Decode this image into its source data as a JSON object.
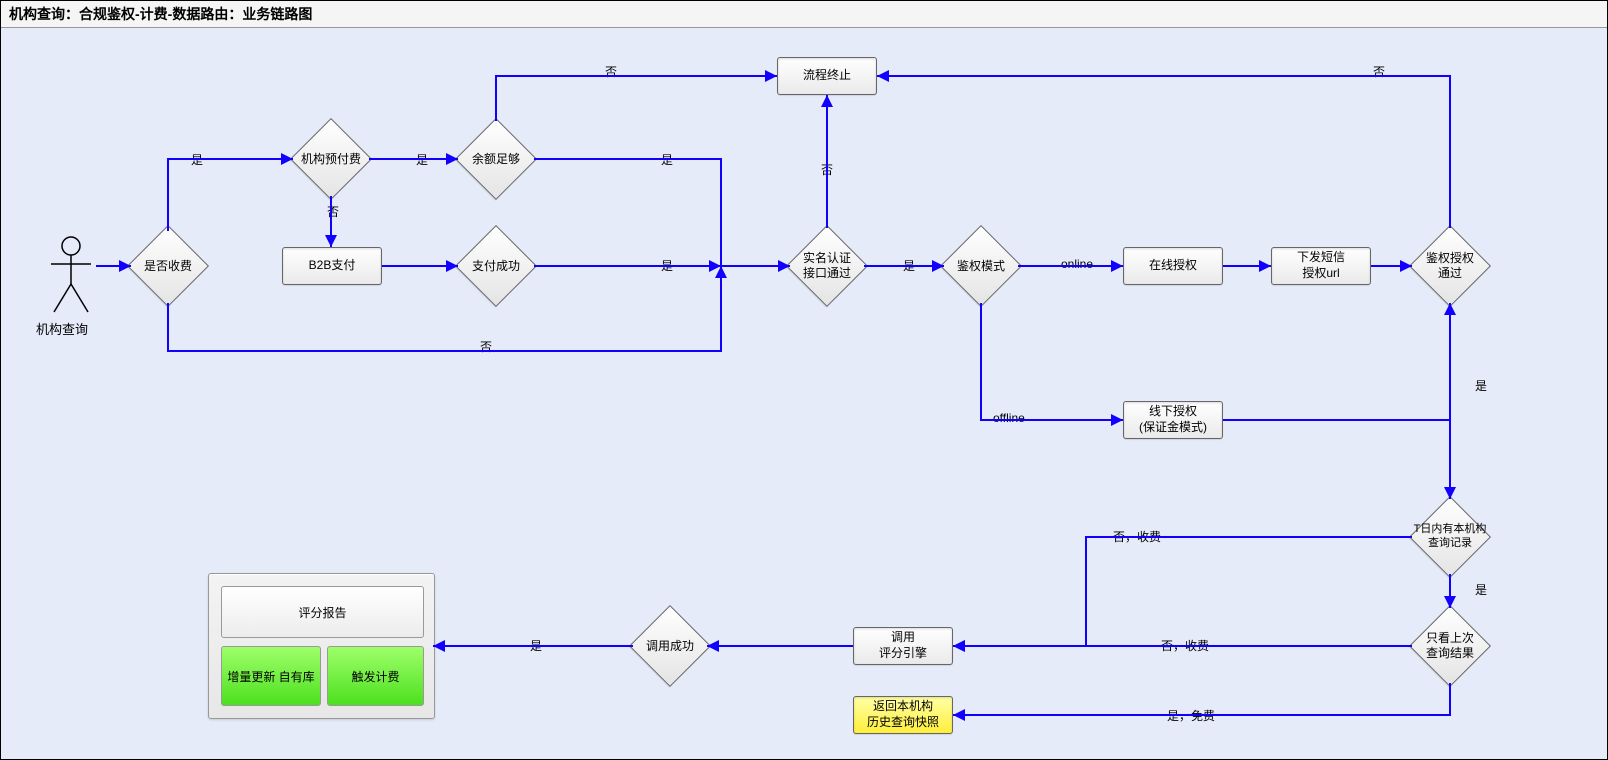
{
  "title": "机构查询：合规鉴权-计费-数据路由：业务链路图",
  "actor": "机构查询",
  "nodes": {
    "isCharge": "是否收费",
    "prepay": "机构预付费",
    "balance": "余额足够",
    "b2b": "B2B支付",
    "paySuccess": "支付成功",
    "halt": "流程终止",
    "realname": "实名认证\n接口通过",
    "authMode": "鉴权模式",
    "onlineAuth": "在线授权",
    "sms": "下发短信\n授权url",
    "authPass": "鉴权授权\n通过",
    "offlineAuth": "线下授权\n(保证金模式)",
    "tday": "T日内有本机构\n查询记录",
    "lookLast": "只看上次\n查询结果",
    "snapshot": "返回本机构\n历史查询快照",
    "callEngine": "调用\n评分引擎",
    "callOk": "调用成功",
    "report": "评分报告",
    "updateLib": "增量更新\n自有库",
    "triggerFee": "触发计费"
  },
  "labels": {
    "yes": "是",
    "no": "否",
    "online": "online",
    "offline": "offline",
    "noCharge": "否，收费",
    "yesFree": "是，免费"
  },
  "colors": {
    "edge": "#1200ff",
    "arrow": "#1200ff"
  }
}
